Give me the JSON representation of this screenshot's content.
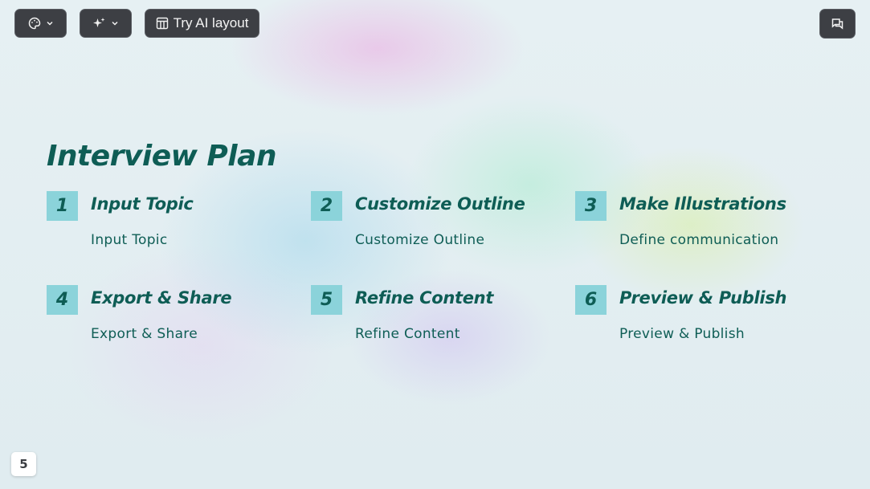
{
  "toolbar": {
    "theme_icon": "palette-icon",
    "ai_icon": "sparkle-icon",
    "layout_icon": "layout-icon",
    "layout_label": "Try AI layout",
    "comment_icon": "comment-icon"
  },
  "slide": {
    "title": "Interview Plan",
    "items": [
      {
        "number": "1",
        "title": "Input Topic",
        "desc": "Input Topic"
      },
      {
        "number": "2",
        "title": "Customize Outline",
        "desc": "Customize Outline"
      },
      {
        "number": "3",
        "title": "Make Illustrations",
        "desc": "Define communication"
      },
      {
        "number": "4",
        "title": "Export & Share",
        "desc": "Export & Share"
      },
      {
        "number": "5",
        "title": "Refine Content",
        "desc": "Refine Content"
      },
      {
        "number": "6",
        "title": "Preview & Publish",
        "desc": "Preview & Publish"
      }
    ]
  },
  "page_number": "5",
  "colors": {
    "accent_text": "#0e5d55",
    "badge_bg": "#8bd3da",
    "toolbar_bg": "#3d3f44"
  }
}
